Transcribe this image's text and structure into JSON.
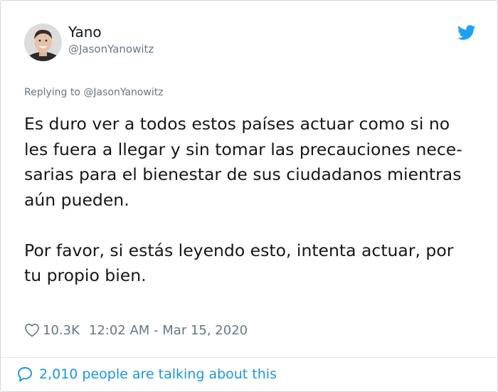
{
  "author": {
    "display_name": "Yano",
    "handle": "@JasonYanowitz"
  },
  "icons": {
    "brand": "twitter-bird-icon",
    "like": "heart-icon",
    "conversation": "speech-bubble-icon"
  },
  "colors": {
    "brand_blue": "#1da1f2",
    "link_blue": "#1b95e0",
    "secondary_text": "#657786",
    "primary_text": "#14171a"
  },
  "tweet": {
    "replying_to": "Replying to @JasonYanowitz",
    "paragraph_1_lines": [
      "Es duro ver a todos estos países actuar como si no",
      "les fuera a llegar y sin tomar las precauciones nece-",
      "sarias para el bienestar de sus ciudadanos mientras",
      "aún pueden."
    ],
    "paragraph_2_lines": [
      "Por favor, si estás leyendo esto, intenta actuar, por",
      "tu propio bien."
    ],
    "likes": "10.3K",
    "timestamp": "12:02 AM - Mar 15, 2020"
  },
  "footer": {
    "conversation_text": "2,010 people are talking about this"
  }
}
